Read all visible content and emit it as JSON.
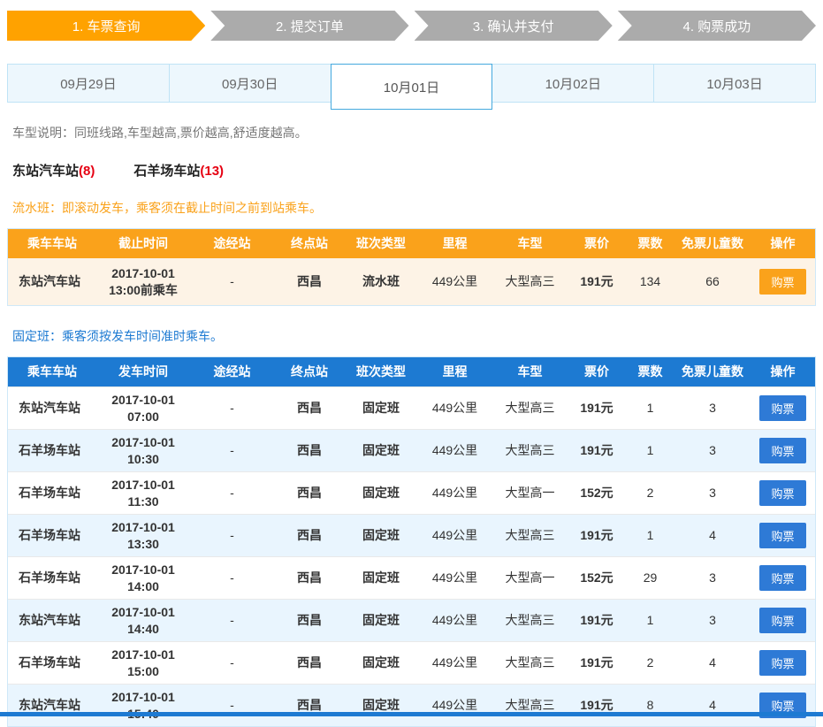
{
  "colors": {
    "accent_orange": "#faa21b",
    "accent_blue": "#1d7ad2",
    "step_inactive": "#ababab",
    "rolling_row_bg": "#fdf3e6",
    "fixed_alt_row_bg": "#e9f5fe",
    "count_red": "#e60012"
  },
  "steps": [
    {
      "label": "1. 车票查询",
      "active": true
    },
    {
      "label": "2. 提交订单",
      "active": false
    },
    {
      "label": "3. 确认并支付",
      "active": false
    },
    {
      "label": "4. 购票成功",
      "active": false
    }
  ],
  "date_tabs": [
    {
      "label": "09月29日",
      "selected": false
    },
    {
      "label": "09月30日",
      "selected": false
    },
    {
      "label": "10月01日",
      "selected": true
    },
    {
      "label": "10月02日",
      "selected": false
    },
    {
      "label": "10月03日",
      "selected": false
    }
  ],
  "notes": {
    "vehicle_note": "车型说明：同班线路,车型越高,票价越高,舒适度越高。",
    "rolling_note": "流水班：即滚动发车，乘客须在截止时间之前到站乘车。",
    "fixed_note": "固定班：乘客须按发车时间准时乘车。"
  },
  "station_filters": [
    {
      "name": "东站汽车站",
      "count": "(8)"
    },
    {
      "name": "石羊场车站",
      "count": "(13)"
    }
  ],
  "rolling_table": {
    "headers": [
      "乘车车站",
      "截止时间",
      "途经站",
      "终点站",
      "班次类型",
      "里程",
      "车型",
      "票价",
      "票数",
      "免票儿童数",
      "操作"
    ],
    "buy_label": "购票",
    "rows": [
      {
        "station": "东站汽车站",
        "time": "2017-10-01\n13:00前乘车",
        "via": "-",
        "dest": "西昌",
        "type": "流水班",
        "distance": "449公里",
        "bus": "大型高三",
        "price": "191元",
        "tickets": "134",
        "free_children": "66"
      }
    ]
  },
  "fixed_table": {
    "headers": [
      "乘车车站",
      "发车时间",
      "途经站",
      "终点站",
      "班次类型",
      "里程",
      "车型",
      "票价",
      "票数",
      "免票儿童数",
      "操作"
    ],
    "buy_label": "购票",
    "rows": [
      {
        "station": "东站汽车站",
        "time": "2017-10-01\n07:00",
        "via": "-",
        "dest": "西昌",
        "type": "固定班",
        "distance": "449公里",
        "bus": "大型高三",
        "price": "191元",
        "tickets": "1",
        "free_children": "3"
      },
      {
        "station": "石羊场车站",
        "time": "2017-10-01\n10:30",
        "via": "-",
        "dest": "西昌",
        "type": "固定班",
        "distance": "449公里",
        "bus": "大型高三",
        "price": "191元",
        "tickets": "1",
        "free_children": "3"
      },
      {
        "station": "石羊场车站",
        "time": "2017-10-01\n11:30",
        "via": "-",
        "dest": "西昌",
        "type": "固定班",
        "distance": "449公里",
        "bus": "大型高一",
        "price": "152元",
        "tickets": "2",
        "free_children": "3"
      },
      {
        "station": "石羊场车站",
        "time": "2017-10-01\n13:30",
        "via": "-",
        "dest": "西昌",
        "type": "固定班",
        "distance": "449公里",
        "bus": "大型高三",
        "price": "191元",
        "tickets": "1",
        "free_children": "4"
      },
      {
        "station": "石羊场车站",
        "time": "2017-10-01\n14:00",
        "via": "-",
        "dest": "西昌",
        "type": "固定班",
        "distance": "449公里",
        "bus": "大型高一",
        "price": "152元",
        "tickets": "29",
        "free_children": "3"
      },
      {
        "station": "东站汽车站",
        "time": "2017-10-01\n14:40",
        "via": "-",
        "dest": "西昌",
        "type": "固定班",
        "distance": "449公里",
        "bus": "大型高三",
        "price": "191元",
        "tickets": "1",
        "free_children": "3"
      },
      {
        "station": "石羊场车站",
        "time": "2017-10-01\n15:00",
        "via": "-",
        "dest": "西昌",
        "type": "固定班",
        "distance": "449公里",
        "bus": "大型高三",
        "price": "191元",
        "tickets": "2",
        "free_children": "4"
      },
      {
        "station": "东站汽车站",
        "time": "2017-10-01\n15:40",
        "via": "-",
        "dest": "西昌",
        "type": "固定班",
        "distance": "449公里",
        "bus": "大型高三",
        "price": "191元",
        "tickets": "8",
        "free_children": "4"
      }
    ]
  }
}
